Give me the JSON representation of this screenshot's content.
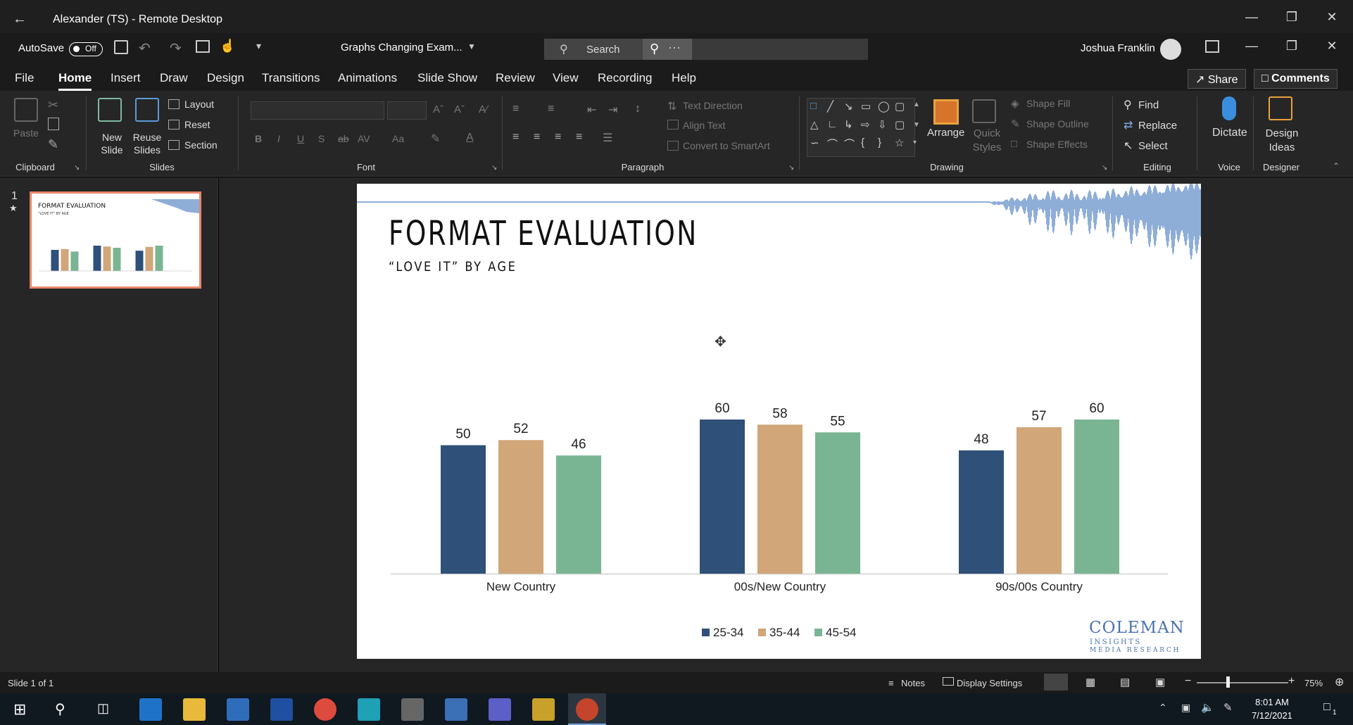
{
  "remote_desktop": {
    "title": "Alexander (TS) - Remote Desktop"
  },
  "quick_access": {
    "autosave_label": "AutoSave",
    "autosave_state": "Off",
    "file_name": "Graphs Changing Exam...",
    "search_label": "Search",
    "user_name": "Joshua Franklin"
  },
  "tabs": [
    "File",
    "Home",
    "Insert",
    "Draw",
    "Design",
    "Transitions",
    "Animations",
    "Slide Show",
    "Review",
    "View",
    "Recording",
    "Help"
  ],
  "active_tab": "Home",
  "share_label": "Share",
  "comments_label": "Comments",
  "ribbon": {
    "clipboard": {
      "paste": "Paste",
      "label": "Clipboard"
    },
    "slides": {
      "new_slide": "New Slide",
      "reuse_slides": "Reuse Slides",
      "layout": "Layout",
      "reset": "Reset",
      "section": "Section",
      "label": "Slides"
    },
    "font": {
      "label": "Font",
      "bold": "B",
      "italic": "I",
      "underline": "U",
      "strike": "S",
      "strike2": "ab",
      "spacing": "AV",
      "case": "Aa"
    },
    "paragraph": {
      "text_direction": "Text Direction",
      "align_text": "Align Text",
      "convert_smartart": "Convert to SmartArt",
      "label": "Paragraph"
    },
    "drawing": {
      "arrange": "Arrange",
      "quick_styles": "Quick Styles",
      "shape_fill": "Shape Fill",
      "shape_outline": "Shape Outline",
      "shape_effects": "Shape Effects",
      "label": "Drawing"
    },
    "editing": {
      "find": "Find",
      "replace": "Replace",
      "select": "Select",
      "label": "Editing"
    },
    "voice": {
      "dictate": "Dictate",
      "label": "Voice"
    },
    "designer": {
      "design_ideas": "Design Ideas",
      "label": "Designer"
    }
  },
  "thumbnail": {
    "number": "1",
    "star": "★"
  },
  "slide": {
    "title": "FORMAT EVALUATION",
    "subtitle": "“LOVE IT” BY AGE",
    "logo_main": "COLEMAN",
    "logo_sub": "INSIGHTS",
    "logo_sub2": "MEDIA RESEARCH"
  },
  "chart_data": {
    "type": "bar",
    "categories": [
      "New Country",
      "00s/New Country",
      "90s/00s Country"
    ],
    "series": [
      {
        "name": "25-34",
        "values": [
          50,
          60,
          48
        ],
        "color": "#2e5079"
      },
      {
        "name": "35-44",
        "values": [
          52,
          58,
          57
        ],
        "color": "#d1a679"
      },
      {
        "name": "45-54",
        "values": [
          46,
          55,
          60
        ],
        "color": "#7ab593"
      }
    ],
    "ylim": [
      0,
      60
    ],
    "grid": false,
    "legend_position": "bottom-center"
  },
  "status": {
    "slide_info": "Slide 1 of 1",
    "notes": "Notes",
    "display_settings": "Display Settings",
    "zoom": "75%"
  },
  "taskbar": {
    "time": "8:01 AM",
    "date": "7/12/2021",
    "notif_count": "1"
  }
}
